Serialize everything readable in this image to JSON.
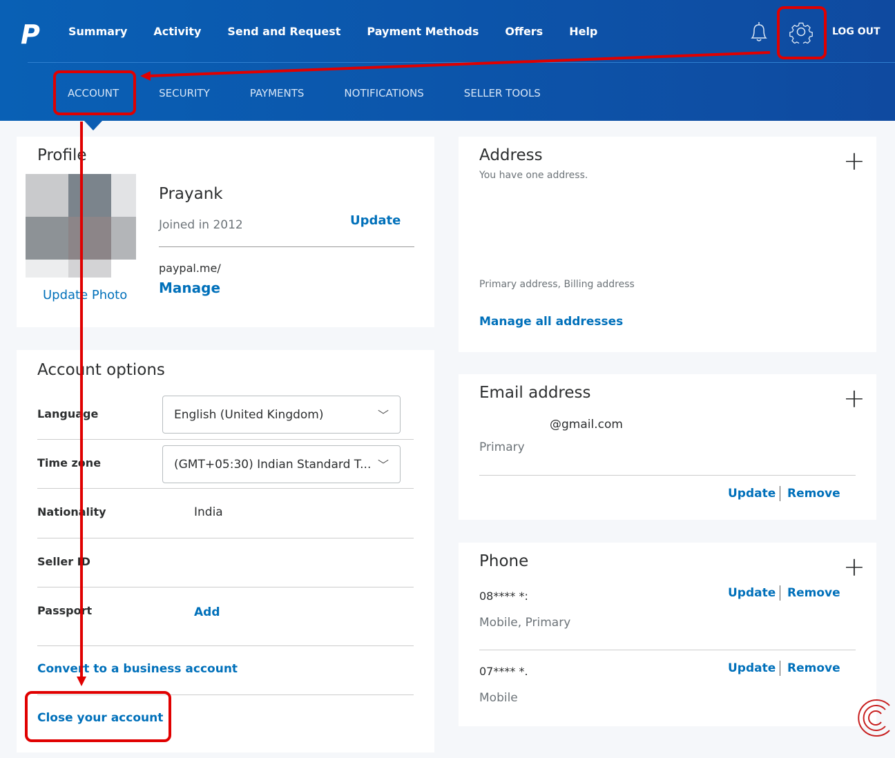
{
  "header": {
    "logo": "P",
    "nav": [
      "Summary",
      "Activity",
      "Send and Request",
      "Payment Methods",
      "Offers",
      "Help"
    ],
    "logout": "LOG OUT",
    "icons": [
      "bell-icon",
      "gear-icon"
    ]
  },
  "subnav": [
    "ACCOUNT",
    "SECURITY",
    "PAYMENTS",
    "NOTIFICATIONS",
    "SELLER TOOLS"
  ],
  "profile": {
    "title": "Profile",
    "name": "Prayank",
    "joined": "Joined in 2012",
    "update": "Update",
    "paypalme": "paypal.me/",
    "manage": "Manage",
    "update_photo": "Update Photo"
  },
  "options": {
    "title": "Account options",
    "language_label": "Language",
    "language_value": "English (United Kingdom)",
    "timezone_label": "Time zone",
    "timezone_value": "(GMT+05:30) Indian Standard T...",
    "nationality_label": "Nationality",
    "nationality_value": "India",
    "seller_label": "Seller ID",
    "passport_label": "Passport",
    "passport_add": "Add",
    "convert": "Convert to a business account",
    "close": "Close your account"
  },
  "address": {
    "title": "Address",
    "subtitle": "You have one address.",
    "type": "Primary address, Billing address",
    "manage": "Manage all addresses"
  },
  "email": {
    "title": "Email address",
    "value": "@gmail.com",
    "primary": "Primary",
    "update": "Update",
    "remove": "Remove"
  },
  "phone": {
    "title": "Phone",
    "items": [
      {
        "number": "08**** *:",
        "type": "Mobile, Primary"
      },
      {
        "number": "07**** *.",
        "type": "Mobile"
      }
    ],
    "update": "Update",
    "remove": "Remove"
  },
  "colors": {
    "header": "#0960b5",
    "link": "#0070ba",
    "annotation": "#e00000"
  }
}
